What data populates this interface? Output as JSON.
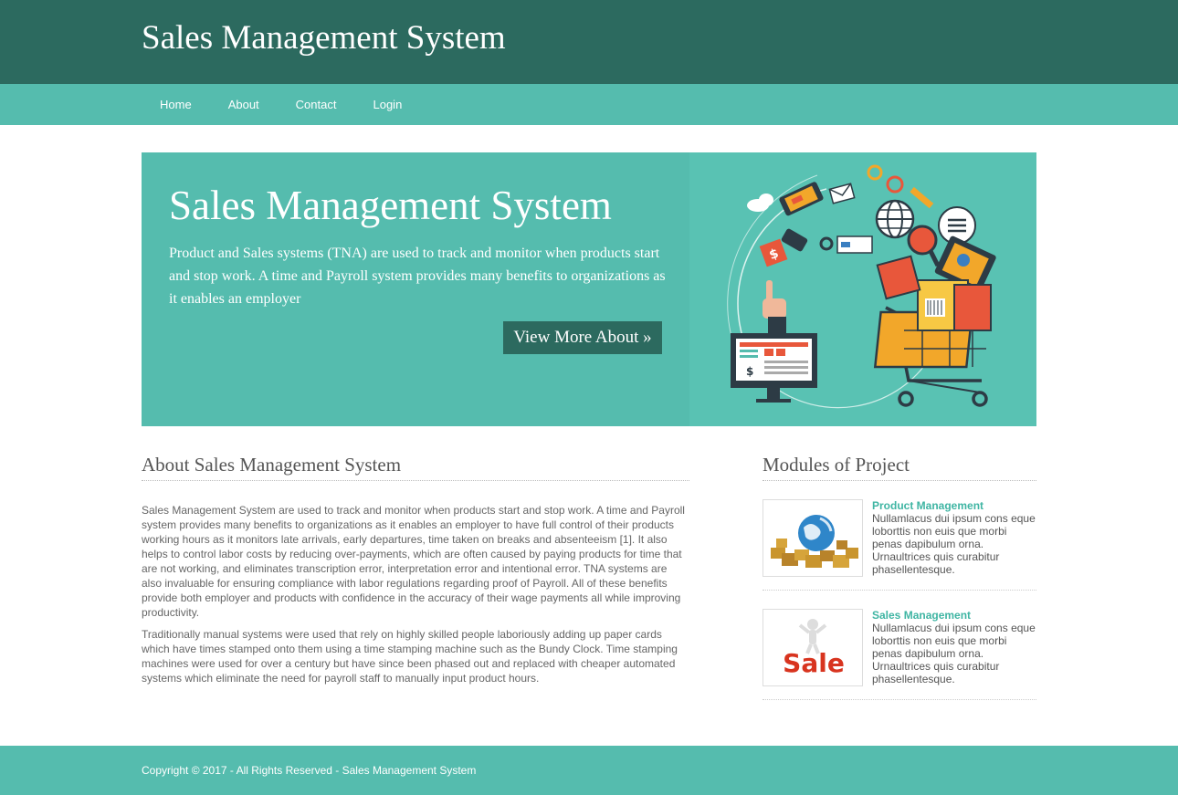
{
  "site": {
    "title": "Sales Management System"
  },
  "nav": {
    "items": [
      {
        "label": "Home"
      },
      {
        "label": "About"
      },
      {
        "label": "Contact"
      },
      {
        "label": "Login"
      }
    ]
  },
  "hero": {
    "title": "Sales Management System",
    "description": "Product and Sales systems (TNA) are used to track and monitor when products start and stop work. A time and Payroll system provides many benefits to organizations as it enables an employer",
    "button_label": "View More About »"
  },
  "about": {
    "heading": "About Sales Management System",
    "paragraphs": [
      "Sales Management System are used to track and monitor when products start and stop work. A time and Payroll system provides many benefits to organizations as it enables an employer to have full control of their products working hours as it monitors late arrivals, early departures, time taken on breaks and absenteeism [1]. It also helps to control labor costs by reducing over-payments, which are often caused by paying products for time that are not working, and eliminates transcription error, interpretation error and intentional error. TNA systems are also invaluable for ensuring compliance with labor regulations regarding proof of Payroll. All of these benefits provide both employer and products with confidence in the accuracy of their wage payments all while improving productivity.",
      "Traditionally manual systems were used that rely on highly skilled people laboriously adding up paper cards which have times stamped onto them using a time stamping machine such as the Bundy Clock. Time stamping machines were used for over a century but have since been phased out and replaced with cheaper automated systems which eliminate the need for payroll staff to manually input product hours."
    ]
  },
  "modules": {
    "heading": "Modules of Project",
    "items": [
      {
        "title": "Product Management",
        "description": "Nullamlacus dui ipsum cons eque loborttis non euis que morbi penas dapibulum orna. Urnaultrices quis curabitur phasellentesque."
      },
      {
        "title": "Sales Management",
        "description": "Nullamlacus dui ipsum cons eque loborttis non euis que morbi penas dapibulum orna. Urnaultrices quis curabitur phasellentesque.",
        "thumb_text": "Sale"
      }
    ]
  },
  "footer": {
    "copyright": "Copyright © 2017 - All Rights Reserved - Sales Management System"
  },
  "colors": {
    "header_dark": "#2c6a5f",
    "teal": "#55bcae",
    "accent_link": "#3fb5a3"
  }
}
